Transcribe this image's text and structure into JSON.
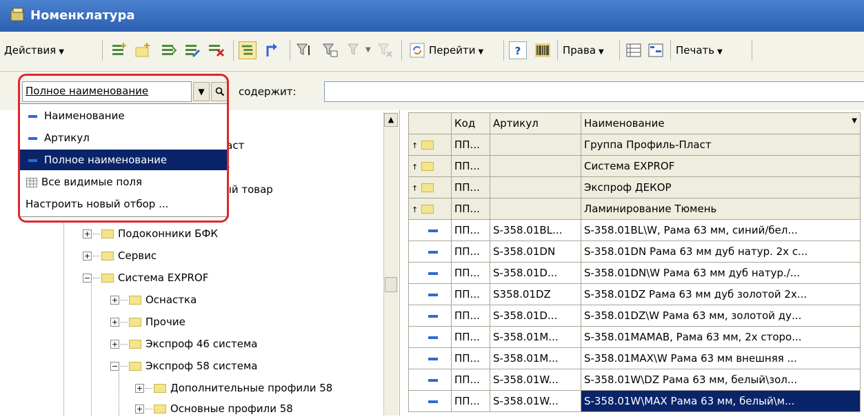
{
  "window": {
    "title": "Номенклатура"
  },
  "toolbar": {
    "actions_label": "Действия",
    "goto_label": "Перейти",
    "help_label": "?",
    "rights_label": "Права",
    "print_label": "Печать"
  },
  "filter": {
    "field_value": "Полное наименование",
    "contains_label": "содержит:"
  },
  "dropdown": {
    "items": [
      "Наименование",
      "Артикул",
      "Полное наименование",
      "Все видимые поля",
      "Настроить новый отбор ..."
    ]
  },
  "tree": {
    "partial": [
      "іаст",
      "е",
      "ый товар"
    ],
    "items": [
      "Подоконники БФК",
      "Сервис",
      "Система EXPROF",
      "Оснастка",
      "Прочие",
      "Экспроф 46 система",
      "Экспроф 58 система",
      "Дополнительные профили 58",
      "Основные профили 58"
    ]
  },
  "table": {
    "headers": [
      "Код",
      "Артикул",
      "Наименование"
    ],
    "rows": [
      {
        "code": "ПП...",
        "art": "",
        "name": "Группа Профиль-Пласт"
      },
      {
        "code": "ПП...",
        "art": "",
        "name": "Система EXPROF"
      },
      {
        "code": "ПП...",
        "art": "",
        "name": "Экспроф ДЕКОР"
      },
      {
        "code": "ПП...",
        "art": "",
        "name": "Ламинирование Тюмень"
      },
      {
        "code": "ПП...",
        "art": "S-358.01BL...",
        "name": "S-358.01BL\\W, Рама 63 мм, синий/бел..."
      },
      {
        "code": "ПП...",
        "art": "S-358.01DN",
        "name": "S-358.01DN Рама 63 мм дуб натур. 2х с..."
      },
      {
        "code": "ПП...",
        "art": "S-358.01D...",
        "name": "S-358.01DN\\W Рама 63 мм дуб натур./..."
      },
      {
        "code": "ПП...",
        "art": "S358.01DZ",
        "name": "S-358.01DZ Рама 63 мм дуб золотой 2х..."
      },
      {
        "code": "ПП...",
        "art": "S-358.01D...",
        "name": "S-358.01DZ\\W Рама 63 мм, золотой ду..."
      },
      {
        "code": "ПП...",
        "art": "S-358.01M...",
        "name": "S-358.01MAMAB, Рама 63 мм, 2х сторо..."
      },
      {
        "code": "ПП...",
        "art": "S-358.01M...",
        "name": "S-358.01MAX\\W Рама 63 мм внешняя ..."
      },
      {
        "code": "ПП...",
        "art": "S-358.01W...",
        "name": "S-358.01W\\DZ Рама 63 мм, белый\\зол..."
      },
      {
        "code": "ПП...",
        "art": "S-358.01W...",
        "name": "S-358.01W\\MAX Рама 63 мм, белый\\м..."
      }
    ]
  }
}
